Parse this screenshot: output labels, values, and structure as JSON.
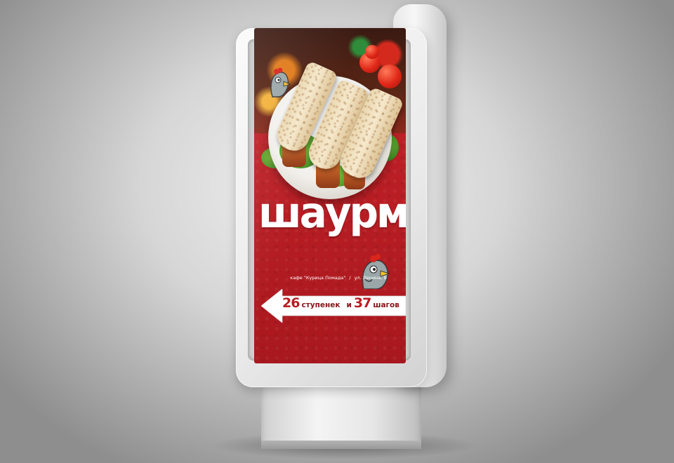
{
  "poster": {
    "title": "шаурма",
    "cafe_name": "кафе \"Курица Помада\"",
    "separator": "/",
    "address": "ул. Ленина, 8",
    "steps_count": "26",
    "steps_word": "ступенек",
    "conjunction": "и",
    "paces_count": "37",
    "paces_word": "шагов",
    "arrow_direction": "left"
  },
  "colors": {
    "poster_red": "#b81e24",
    "arrow_white": "#ffffff",
    "cabinet_silver": "#e6e6e6"
  }
}
